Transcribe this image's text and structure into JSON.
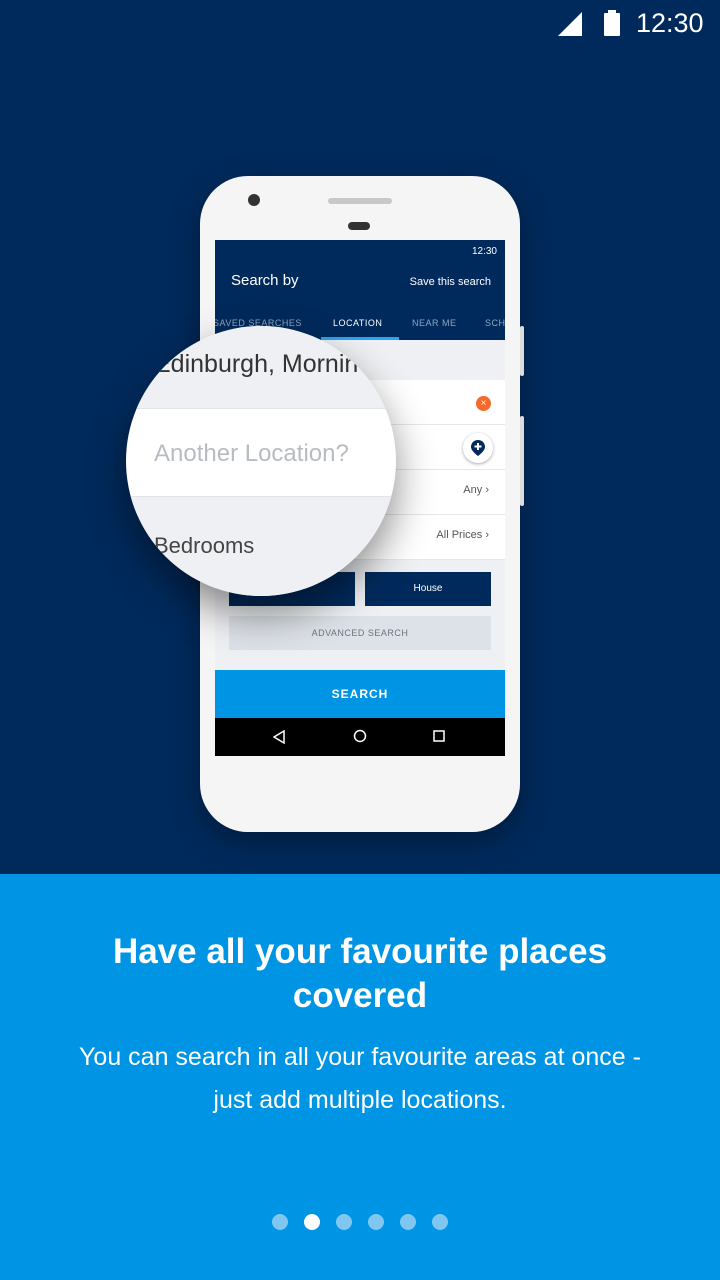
{
  "status_bar": {
    "time": "12:30"
  },
  "phone_screen": {
    "status_time": "12:30",
    "title": "Search by",
    "save_link": "Save this search",
    "tabs": [
      "SAVED SEARCHES",
      "LOCATION",
      "NEAR ME",
      "SCH"
    ],
    "active_tab": "LOCATION",
    "rows": {
      "type_value": "Any",
      "price_value": "All Prices"
    },
    "property_button": "House",
    "advanced_search": "ADVANCED SEARCH",
    "search_button": "SEARCH"
  },
  "magnifier": {
    "location_text": "Edinburgh, Mornin",
    "another_location_placeholder": "Another Location?",
    "bedrooms_label": "Bedrooms"
  },
  "onboarding": {
    "headline": "Have all your favourite places covered",
    "body": "You can search in all your favourite areas at once - just add multiple locations.",
    "page_count": 6,
    "active_page": 2
  },
  "colors": {
    "navy": "#002a5c",
    "accent_blue": "#0094e4",
    "clear_orange": "#f36a2a"
  },
  "icons": [
    "signal-icon",
    "battery-icon",
    "close-icon",
    "location-pin-icon",
    "back-icon",
    "home-icon",
    "recents-icon"
  ]
}
